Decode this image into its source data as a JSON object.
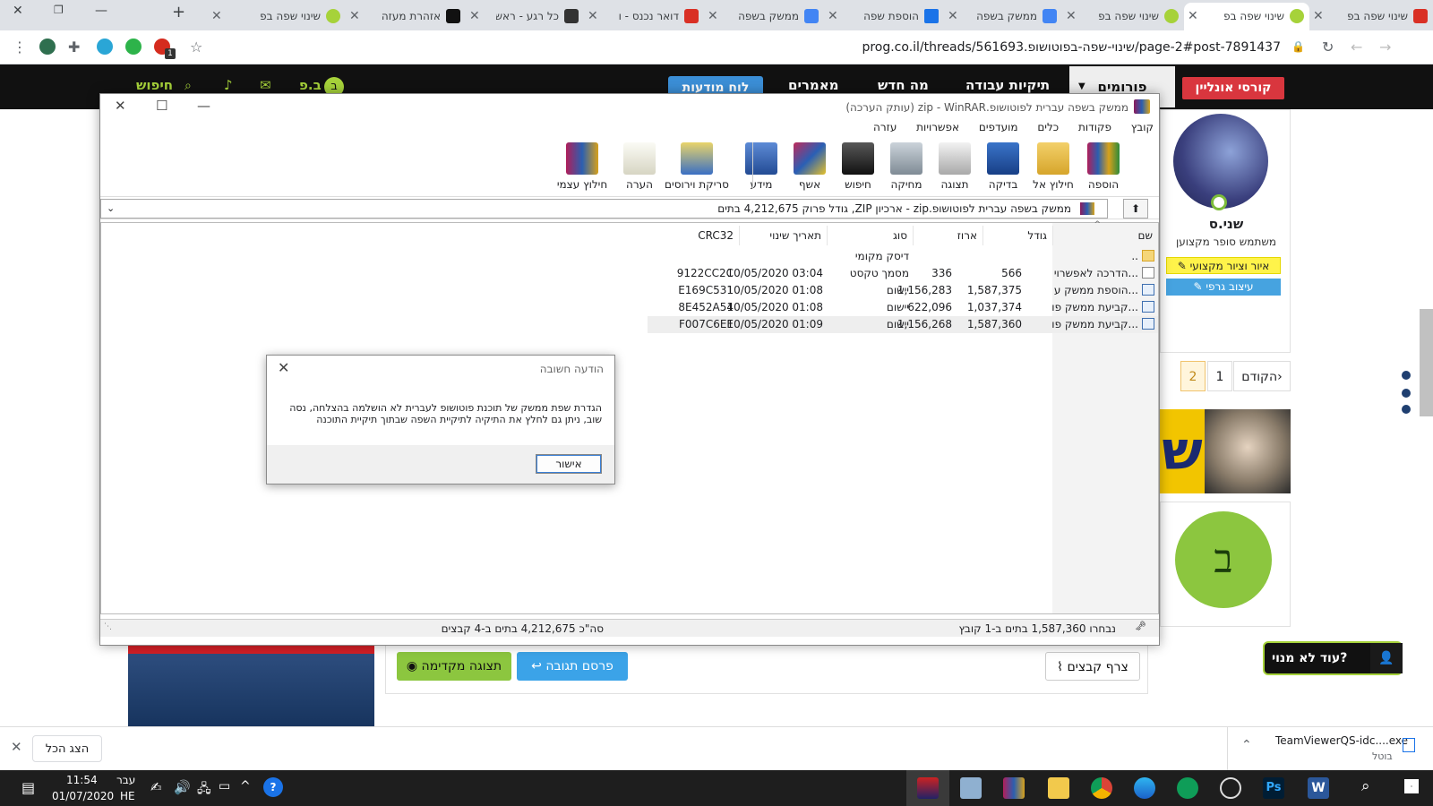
{
  "browser": {
    "tabs": [
      {
        "title": "שינוי שפה בפ",
        "active": false
      },
      {
        "title": "שינוי שפה בפ",
        "active": true
      },
      {
        "title": "שינוי שפה בפ",
        "active": false
      },
      {
        "title": "ממשק בשפה",
        "active": false
      },
      {
        "title": "הוספת שפה",
        "active": false
      },
      {
        "title": "ממשק בשפה",
        "active": false
      },
      {
        "title": "דואר נכנס - ו",
        "active": false
      },
      {
        "title": "כל רגע - ראשי",
        "active": false
      },
      {
        "title": "אזהרת מעזה",
        "active": false
      },
      {
        "title": "שינוי שפה בפ",
        "active": false
      }
    ],
    "url": "prog.co.il/threads/561693.שינוי-שפה-בפוטושופ/page-2#post-7891437",
    "extension_badge": "1"
  },
  "site": {
    "nav": {
      "courses": "קורסי אונליין",
      "forums": "פורומים",
      "work_files": "תיקיות עבודה",
      "whats_new": "מה חדש",
      "articles": "מאמרים",
      "noticeboard": "לוח מודעות",
      "user_initial": "ב",
      "user_short": "ב.פ",
      "search": "חיפוש"
    },
    "profile": {
      "name": "שני.ס",
      "title": "משתמש סופר מקצוען",
      "tag1": "איור וציור מקצועי",
      "tag2": "עיצוב גרפי"
    },
    "pager": {
      "prev": "הקודם",
      "p1": "1",
      "p2": "2"
    },
    "avatar_letter": "ב",
    "reply": {
      "attach": "צרף קבצים",
      "post": "פרסם תגובה",
      "preview": "תצוגה מקדימה"
    },
    "not_subscribed": "עוד לא מנוי?"
  },
  "winrar": {
    "title": "ממשק בשפה עברית לפוטושופ.zip - WinRAR (עותק הערכה)",
    "menu": [
      "קובץ",
      "פקודות",
      "כלים",
      "מועדפים",
      "אפשרויות",
      "עזרה"
    ],
    "tools": [
      "הוספה",
      "חילוץ אל",
      "בדיקה",
      "תצוגה",
      "מחיקה",
      "חיפוש",
      "אשף",
      "מידע",
      "סריקת וירוסים",
      "הערה",
      "חילוץ עצמי"
    ],
    "path": "ממשק בשפה עברית לפוטושופ.zip - ארכיון ZIP, גודל פרוק 4,212,675 בתים",
    "columns": {
      "name": "שם",
      "size": "גודל",
      "packed": "ארוז",
      "type": "סוג",
      "modified": "תאריך שינוי",
      "crc": "CRC32"
    },
    "rows": [
      {
        "name": "..",
        "size": "",
        "packed": "",
        "type": "דיסק מקומי",
        "modified": "",
        "crc": ""
      },
      {
        "name": "הדרכה לאפשרוי...",
        "size": "566",
        "packed": "336",
        "type": "מסמך טקסט",
        "modified": "10/05/2020 03:04",
        "crc": "9122CC2C"
      },
      {
        "name": "הוספת ממשק ע...",
        "size": "1,587,375",
        "packed": "1,156,283",
        "type": "יישום",
        "modified": "10/05/2020 01:08",
        "crc": "E169C531"
      },
      {
        "name": "קביעת ממשק פו...",
        "size": "1,037,374",
        "packed": "622,096",
        "type": "יישום",
        "modified": "10/05/2020 01:08",
        "crc": "8E452A54"
      },
      {
        "name": "קביעת ממשק פו...",
        "size": "1,587,360",
        "packed": "1,156,268",
        "type": "יישום",
        "modified": "10/05/2020 01:09",
        "crc": "F007C6EE"
      }
    ],
    "status_selected": "נבחרו 1,587,360 בתים ב-1 קובץ",
    "status_total": "סה\"כ 4,212,675 בתים ב-4 קבצים"
  },
  "dialog": {
    "title": "הודעה חשובה",
    "message": "הגדרת שפת ממשק של תוכנת פוטושופ לעברית לא הושלמה בהצלחה, נסה שוב, ניתן גם לחלץ את התיקיה לתיקיית השפה שבתוך תיקיית התוכנה",
    "ok": "אישור"
  },
  "downloads": {
    "show_all": "הצג הכל",
    "file": "TeamViewerQS-idc....exe",
    "status": "בוטל"
  },
  "taskbar": {
    "lang1": "עבר",
    "lang2": "HE",
    "time": "11:54",
    "date": "01/07/2020"
  },
  "colors": {
    "accent_green": "#8cc63f",
    "nav_black": "#111111",
    "red": "#d9363e",
    "blue": "#3b8ed6"
  }
}
